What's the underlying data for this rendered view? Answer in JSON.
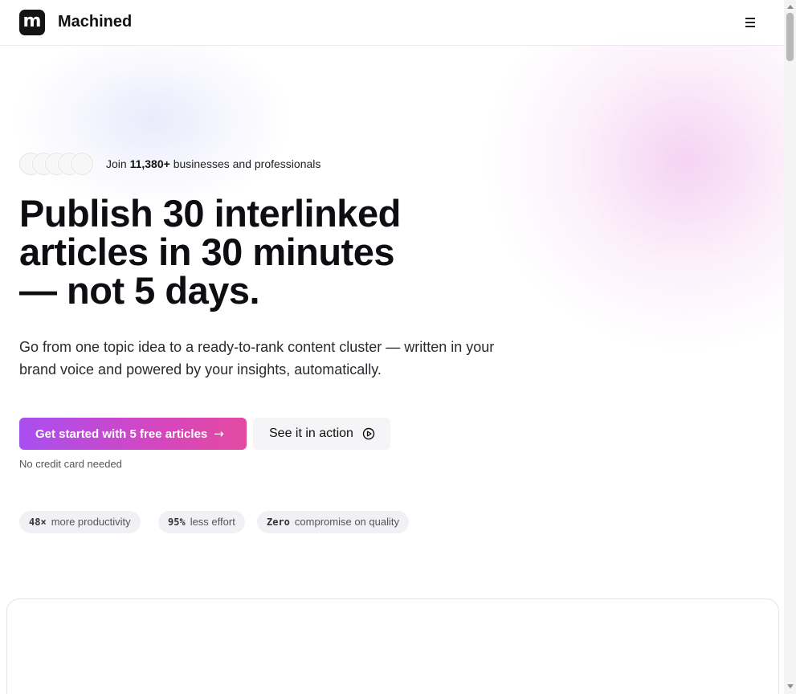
{
  "header": {
    "logo_letter": "m",
    "brand_name": "Machined",
    "menu_icon": "hamburger-menu-icon"
  },
  "hero": {
    "social_proof": {
      "prefix": "Join",
      "count": "11,380+",
      "suffix": "businesses and professionals",
      "avatar_count": 5
    },
    "headline_lines": [
      "Publish 30 interlinked",
      "articles in 30 minutes",
      "— not 5 days."
    ],
    "subcopy": "Go from one topic idea to a ready-to-rank content cluster — written in your brand voice and powered by your insights, automatically.",
    "primary_cta": "Get started with 5 free articles",
    "primary_cta_icon": "arrow-right-icon",
    "secondary_cta": "See it in action",
    "secondary_cta_icon": "play-circle-icon",
    "note": "No credit card needed"
  },
  "stats": [
    {
      "value": "48×",
      "label": "more productivity"
    },
    {
      "value": "95%",
      "label": "less effort"
    },
    {
      "value": "Zero",
      "label": "compromise on quality"
    }
  ],
  "colors": {
    "cta_gradient_start": "#a84ff0",
    "cta_gradient_end": "#e44aa0",
    "logo_bg": "#141414",
    "pill_bg": "#f1f1f5"
  }
}
